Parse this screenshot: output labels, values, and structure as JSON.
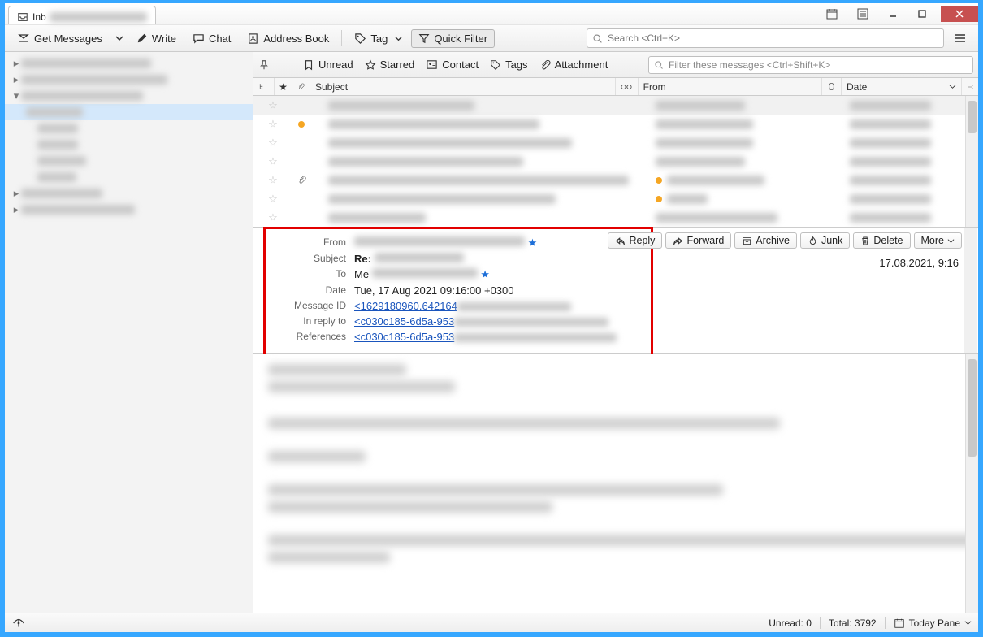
{
  "window": {
    "tab_title": "Inb"
  },
  "toolbar": {
    "get_messages": "Get Messages",
    "write": "Write",
    "chat": "Chat",
    "address_book": "Address Book",
    "tag": "Tag",
    "quick_filter": "Quick Filter",
    "search_placeholder": "Search <Ctrl+K>"
  },
  "filter": {
    "unread": "Unread",
    "starred": "Starred",
    "contact": "Contact",
    "tags": "Tags",
    "attachment": "Attachment",
    "placeholder": "Filter these messages <Ctrl+Shift+K>"
  },
  "columns": {
    "subject": "Subject",
    "from": "From",
    "date": "Date"
  },
  "message": {
    "labels": {
      "from": "From",
      "subject": "Subject",
      "to": "To",
      "date": "Date",
      "message_id": "Message ID",
      "in_reply_to": "In reply to",
      "references": "References"
    },
    "subject_prefix": "Re: ",
    "to_value": "Me ",
    "date_value": "Tue, 17 Aug 2021 09:16:00 +0300",
    "message_id_value": "<1629180960.642164",
    "in_reply_to_value": "<c030c185-6d5a-953",
    "references_value": "<c030c185-6d5a-953",
    "received": "17.08.2021, 9:16"
  },
  "actions": {
    "reply": "Reply",
    "forward": "Forward",
    "archive": "Archive",
    "junk": "Junk",
    "delete": "Delete",
    "more": "More"
  },
  "status": {
    "unread": "Unread: 0",
    "total": "Total: 3792",
    "today_pane": "Today Pane"
  }
}
